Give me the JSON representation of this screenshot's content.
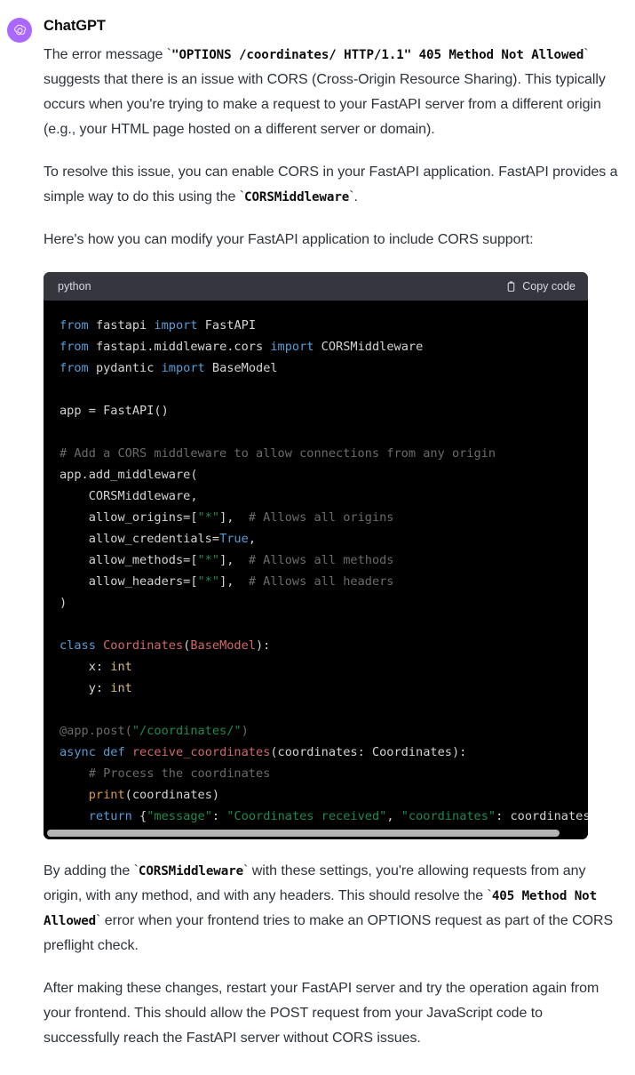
{
  "message": {
    "author": "ChatGPT",
    "avatar_icon": "openai-logo-icon",
    "avatar_color": "#ab68ff"
  },
  "paragraphs": {
    "p1_a": "The error message `",
    "p1_code": "\"OPTIONS /coordinates/ HTTP/1.1\" 405 Method Not Allowed",
    "p1_b": "` suggests that there is an issue with CORS (Cross-Origin Resource Sharing). This typically occurs when you're trying to make a request to your FastAPI server from a different origin (e.g., your HTML page hosted on a different server or domain).",
    "p2_a": "To resolve this issue, you can enable CORS in your FastAPI application. FastAPI provides a simple way to do this using the `",
    "p2_code": "CORSMiddleware",
    "p2_b": "`.",
    "p3": "Here's how you can modify your FastAPI application to include CORS support:",
    "p4_a": "By adding the `",
    "p4_code1": "CORSMiddleware",
    "p4_b": "` with these settings, you're allowing requests from any origin, with any method, and with any headers. This should resolve the `",
    "p4_code2": "405 Method Not Allowed",
    "p4_c": "` error when your frontend tries to make an OPTIONS request as part of the CORS preflight check.",
    "p5": "After making these changes, restart your FastAPI server and try the operation again from your frontend. This should allow the POST request from your JavaScript code to successfully reach the FastAPI server without CORS issues."
  },
  "code_block": {
    "language": "python",
    "copy_label": "Copy code",
    "copy_icon": "clipboard-icon",
    "background": "#000000",
    "header_background": "#35363e",
    "lines": [
      "from fastapi import FastAPI",
      "from fastapi.middleware.cors import CORSMiddleware",
      "from pydantic import BaseModel",
      "",
      "app = FastAPI()",
      "",
      "# Add a CORS middleware to allow connections from any origin",
      "app.add_middleware(",
      "    CORSMiddleware,",
      "    allow_origins=[\"*\"],  # Allows all origins",
      "    allow_credentials=True,",
      "    allow_methods=[\"*\"],  # Allows all methods",
      "    allow_headers=[\"*\"],  # Allows all headers",
      ")",
      "",
      "class Coordinates(BaseModel):",
      "    x: int",
      "    y: int",
      "",
      "@app.post(\"/coordinates/\")",
      "async def receive_coordinates(coordinates: Coordinates):",
      "    # Process the coordinates",
      "    print(coordinates)",
      "    return {\"message\": \"Coordinates received\", \"coordinates\": coordinates}"
    ]
  }
}
